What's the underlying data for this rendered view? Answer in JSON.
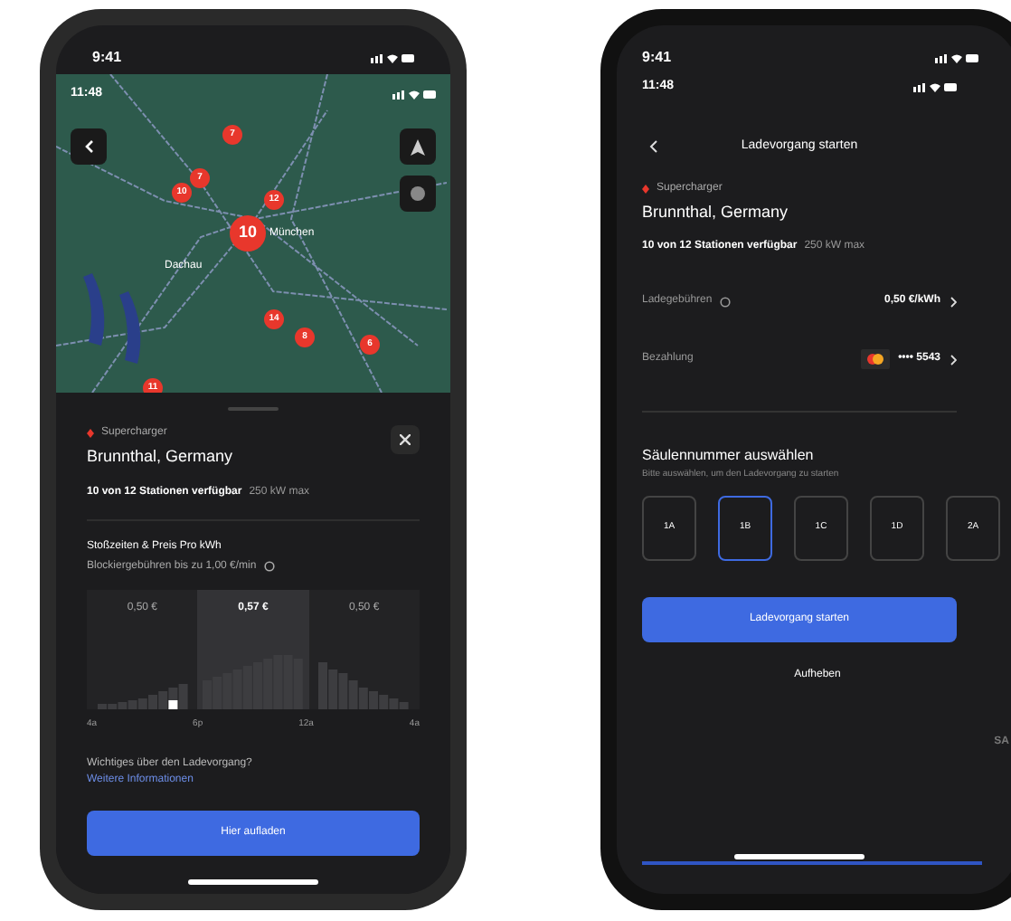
{
  "left_phone": {
    "status_time": "9:41",
    "map": {
      "status_time": "11:48",
      "labels": [
        "Dachau",
        "München"
      ],
      "pins": [
        "7",
        "7",
        "10",
        "12",
        "10",
        "14",
        "8",
        "6",
        "11"
      ]
    },
    "sheet": {
      "category": "Supercharger",
      "location": "Brunnthal, Germany",
      "availability": "10 von 12 Stationen verfügbar",
      "power": "250 kW max",
      "pricing_title": "Stoßzeiten & Preis Pro kWh",
      "pricing_note": "Blockiergebühren bis zu 1,00 €/min",
      "price_segments": [
        {
          "label": "0,50 €",
          "selected": false
        },
        {
          "label": "0,57 €",
          "selected": true
        },
        {
          "label": "0,50 €",
          "selected": false
        }
      ],
      "time_labels": [
        "4a",
        "6p",
        "12a",
        "4a"
      ],
      "question": "Wichtiges über den Ladevorgang?",
      "link": "Weitere Informationen",
      "button": "Hier aufladen"
    }
  },
  "right_phone": {
    "status_time": "9:41",
    "inner_time": "11:48",
    "title": "Ladevorgang starten",
    "category": "Supercharger",
    "location": "Brunnthal, Germany",
    "availability": "10 von 12 Stationen verfügbar",
    "power": "250 kW max",
    "rows": [
      {
        "label": "Ladegebühren",
        "value": "0,50 €/kWh",
        "kind": "info"
      },
      {
        "label": "Bezahlung",
        "value": "•••• 5543",
        "kind": "card"
      }
    ],
    "stall_title": "Säulennummer auswählen",
    "stall_hint": "Bitte auswählen, um den Ladevorgang zu starten",
    "stalls": [
      {
        "label": "1A",
        "selected": false
      },
      {
        "label": "1B",
        "selected": true
      },
      {
        "label": "1C",
        "selected": false
      },
      {
        "label": "1D",
        "selected": false
      },
      {
        "label": "2A",
        "selected": false
      }
    ],
    "button": "Ladevorgang starten",
    "cancel": "Aufheben"
  },
  "background_card_text": "SA"
}
